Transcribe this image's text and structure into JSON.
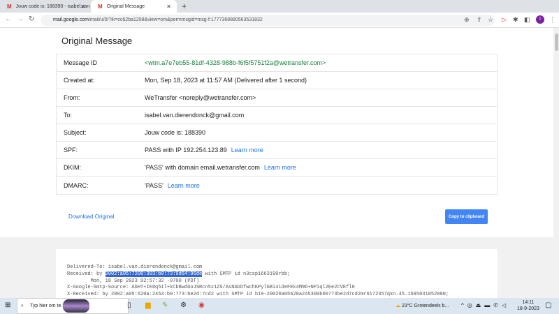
{
  "browser": {
    "tabs": [
      {
        "label": "Jouw code is: 188390 - isabel.van"
      },
      {
        "label": "Original Message"
      }
    ],
    "url_host": "mail.google.com",
    "url_path": "/mail/u/0/?ik=cc62ba1298&view=om&permmsgid=msg-f:1777368880563531832",
    "avatar": "I"
  },
  "page": {
    "title": "Original Message",
    "rows": [
      {
        "key": "Message ID",
        "value": "<wtm.a7e7eb55-81df-4328-988b-f6f5f5751f2a@wetransfer.com>"
      },
      {
        "key": "Created at:",
        "value": "Mon, Sep 18, 2023 at 11:57 AM (Delivered after 1 second)"
      },
      {
        "key": "From:",
        "value": "WeTransfer <noreply@wetransfer.com>"
      },
      {
        "key": "To:",
        "value": "isabel.van.dierendonck@gmail.com"
      },
      {
        "key": "Subject:",
        "value": "Jouw code is: 188390"
      },
      {
        "key": "SPF:",
        "value": "PASS with IP 192.254.123.89",
        "link": "Learn more"
      },
      {
        "key": "DKIM:",
        "value": "'PASS' with domain email.wetransfer.com",
        "link": "Learn more"
      },
      {
        "key": "DMARC:",
        "value": "'PASS'",
        "link": "Learn more"
      }
    ],
    "download": "Download Original",
    "copy": "Copy to clipboard",
    "raw": {
      "l1": "Delivered-To: isabel.van.dierendonck@gmail.com",
      "l2a": "Received: by ",
      "l2h": "2002:a05:7208:303:b0:73:9d64:96de",
      "l2b": " with SMTP id n3csp1663190rbb;",
      "l3": "        Mon, 18 Sep 2023 02:57:32 -0700 (PDT)",
      "l4": "X-Google-Smtp-Source: AGHT+IE8q51l+kCbBwdGoJSRcn5z1ZS/AsNAbDfwchKPylGBi4ideFEk4M9D+NPiql2Ee2CVEfl0",
      "l5": "X-Received: by 2002:a05:620a:2453:b0:773:be2d:7cd2 with SMTP id h19-20020a05620a245300b00773be2d7cd2mr6172357qkn.45.1695031052000;"
    }
  },
  "taskbar": {
    "search": "Typ hier om te zoeken",
    "weather": "23°C  Grotendeels b...",
    "time": "14:11",
    "date": "18-9-2023"
  }
}
